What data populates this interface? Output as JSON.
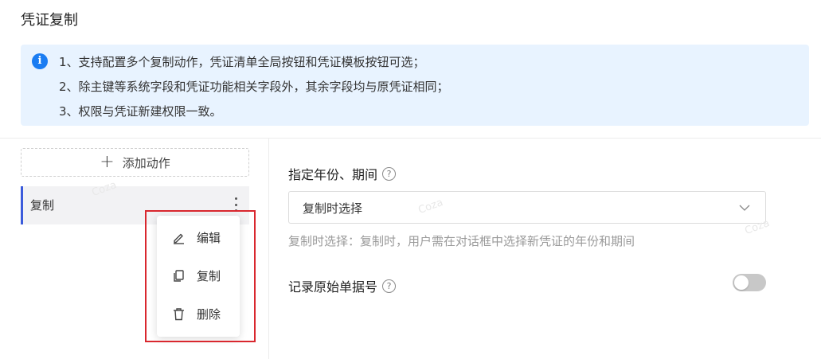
{
  "page": {
    "title": "凭证复制"
  },
  "notice": {
    "icon": "info-icon",
    "icon_glyph": "i",
    "lines": [
      "1、支持配置多个复制动作，凭证清单全局按钮和凭证模板按钮可选；",
      "2、除主键等系统字段和凭证功能相关字段外，其余字段均与原凭证相同；",
      "3、权限与凭证新建权限一致。"
    ],
    "colors": {
      "background": "#e8f3ff",
      "icon": "#1a7cf2"
    }
  },
  "left_panel": {
    "add_action_label": "添加动作",
    "add_icon": "plus-icon",
    "actions": [
      {
        "label": "复制",
        "active": true
      }
    ],
    "more_icon": "more-vertical-icon",
    "active_color": "#3b5bdb"
  },
  "context_menu": {
    "items": [
      {
        "label": "编辑",
        "icon": "edit-icon"
      },
      {
        "label": "复制",
        "icon": "copy-icon"
      },
      {
        "label": "删除",
        "icon": "trash-icon"
      }
    ],
    "highlight_color": "#d9272e"
  },
  "form": {
    "period": {
      "label": "指定年份、期间",
      "help_icon": "question-icon",
      "help_glyph": "?",
      "selected_value": "复制时选择",
      "hint": "复制时选择：复制时，用户需在对话框中选择新凭证的年份和期间"
    },
    "record_source": {
      "label": "记录原始单据号",
      "help_icon": "question-icon",
      "help_glyph": "?",
      "enabled": false
    }
  },
  "watermark": {
    "text": "Coza"
  }
}
